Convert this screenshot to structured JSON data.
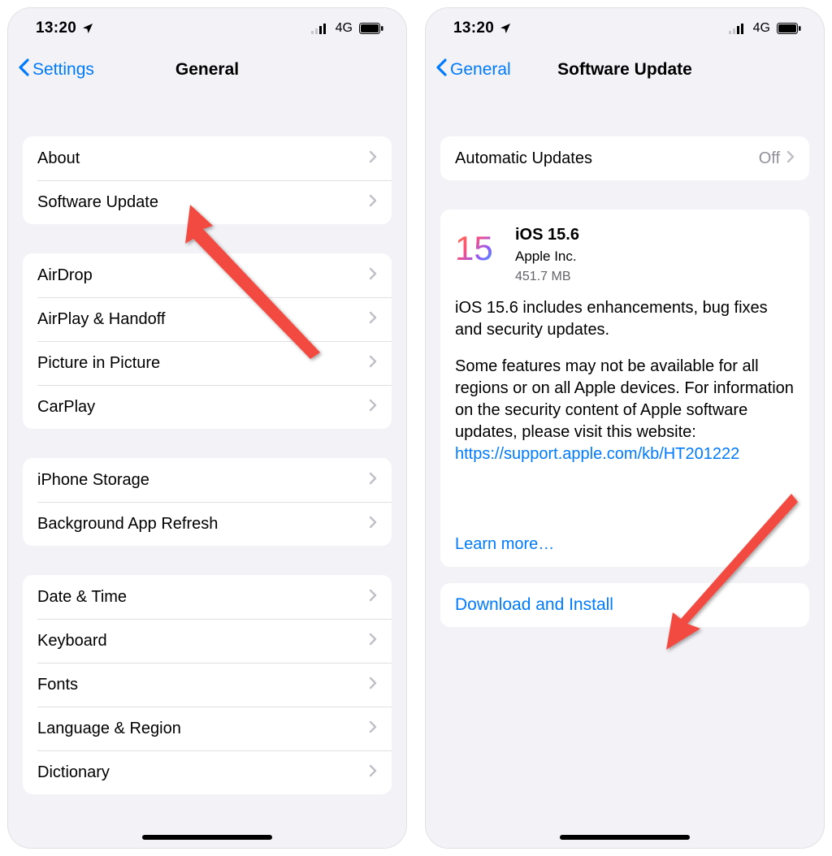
{
  "statusbar": {
    "time": "13:20",
    "network": "4G"
  },
  "left": {
    "back_label": "Settings",
    "title": "General",
    "groups": [
      {
        "rows": [
          {
            "label": "About"
          },
          {
            "label": "Software Update"
          }
        ]
      },
      {
        "rows": [
          {
            "label": "AirDrop"
          },
          {
            "label": "AirPlay & Handoff"
          },
          {
            "label": "Picture in Picture"
          },
          {
            "label": "CarPlay"
          }
        ]
      },
      {
        "rows": [
          {
            "label": "iPhone Storage"
          },
          {
            "label": "Background App Refresh"
          }
        ]
      },
      {
        "rows": [
          {
            "label": "Date & Time"
          },
          {
            "label": "Keyboard"
          },
          {
            "label": "Fonts"
          },
          {
            "label": "Language & Region"
          },
          {
            "label": "Dictionary"
          }
        ]
      }
    ]
  },
  "right": {
    "back_label": "General",
    "title": "Software Update",
    "auto_updates": {
      "label": "Automatic Updates",
      "value": "Off"
    },
    "update": {
      "name": "iOS 15.6",
      "vendor": "Apple Inc.",
      "size": "451.7 MB",
      "para1": "iOS 15.6 includes enhancements, bug fixes and security updates.",
      "para2": "Some features may not be available for all regions or on all Apple devices. For information on the security content of Apple software updates, please visit this website:",
      "link": "https://support.apple.com/kb/HT201222",
      "learn_more": "Learn more…",
      "action": "Download and Install"
    }
  }
}
